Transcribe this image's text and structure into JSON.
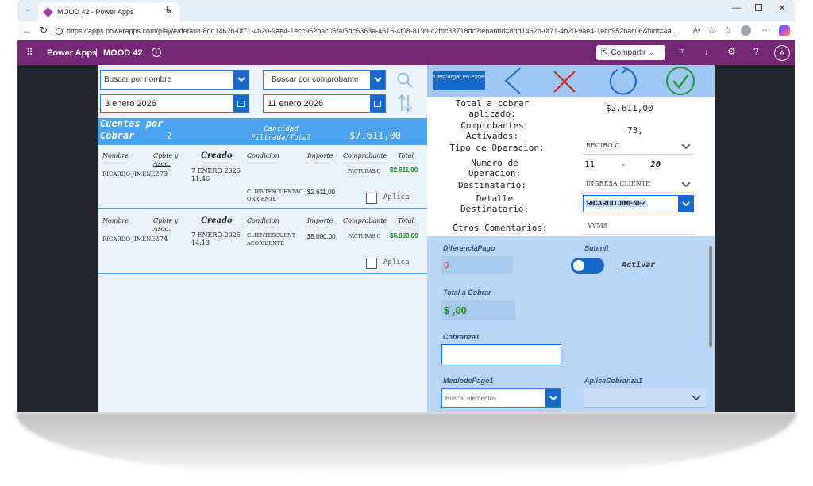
{
  "browser": {
    "tab_title": "MOOD 42 - Power Apps",
    "url": "https://apps.powerapps.com/play/e/default-8dd1462b-0f71-4b20-9ae4-1ecc952bac06/a/5dc6363a-4616-4f08-8199-c2fbc33718dc?tenantId=8dd1462b-0f71-4b20-9ae4-1ecc952bac06&hint=4a...",
    "read_aloud": "Aᵃ"
  },
  "app_bar": {
    "brand": "Power Apps",
    "separator": "|",
    "app_name": "MOOD 42",
    "share_label": "Compartir",
    "avatar_letter": "A"
  },
  "filters": {
    "search_name_placeholder": "Buscar por nombre",
    "search_comprobante_placeholder": "Buscar por comprobante",
    "date_from": "3 enero 2026",
    "date_to": "11 enero 2026"
  },
  "summary": {
    "title": "Cuentas por Cobrar",
    "count": "2",
    "cantidad_label": "Cantidad Filtrada/Total",
    "total": "$7.611,00"
  },
  "columns": {
    "nombre": "Nombre",
    "cpbte": "Cpbte y Asoc.",
    "creado": "Creado",
    "condicion": "Condicion",
    "importe": "Importe",
    "comprobante": "Comprobante",
    "total": "Total"
  },
  "rows": [
    {
      "nombre": "RICARDO JIMENEZ",
      "cpbte": "73",
      "creado": "7 ENERO 2026 11:46",
      "condicion": "CLIENTESCUENTAC ORRIENTE",
      "importe": "$2.611,00",
      "comprobante": "FACTURAS C",
      "total": "$2.611,00",
      "aplica": "Aplica"
    },
    {
      "nombre": "RICARDO JIMENEZ",
      "cpbte": "74",
      "creado": "7 ENERO 2026 14:13",
      "condicion": "CLIENTESCUENT ACORRIENTE",
      "importe": "$5.000,00",
      "comprobante": "FACTURAS C",
      "total": "$5.000,00",
      "aplica": "Aplica"
    }
  ],
  "toolbar": {
    "excel_label": "Descargar en excel"
  },
  "detail": {
    "total_label": "Total a cobrar aplicado:",
    "total_value": "$2.611,00",
    "comprobantes_label": "Comprobantes Activados:",
    "comprobantes_value": "73,",
    "tipo_label": "Tipo de Operacion:",
    "tipo_value": "RECIBO C",
    "numero_label": "Numero de Operacion:",
    "numero_a": "11",
    "numero_sep": "-",
    "numero_b": "20",
    "destinatario_label": "Destinatario:",
    "destinatario_value": "INGRESA CLIENTE",
    "detalle_label": "Detalle Destinatario:",
    "detalle_value": "RICARDO JIMENEZ",
    "otros_label": "Otros Comentarios:",
    "otros_value": "VVMS"
  },
  "form": {
    "diferencia_label": "DiferenciaPago",
    "diferencia_value": "0",
    "submit_label": "Submit",
    "activar_label": "Activar",
    "total_cobrar_label": "Total a Cobrar",
    "total_cobrar_value": "$ ,00",
    "cobranza_label": "Cobranza1",
    "cobranza_value": "",
    "medio_label": "MediodePago1",
    "medio_placeholder": "Buscar elementos",
    "aplica_label": "AplicaCobranza1"
  },
  "colors": {
    "app_bar": "#742774",
    "accent_blue": "#1769c9",
    "summary_band": "#4aa3ec",
    "total_green": "#1a8a1a",
    "cancel_red": "#e02020"
  }
}
